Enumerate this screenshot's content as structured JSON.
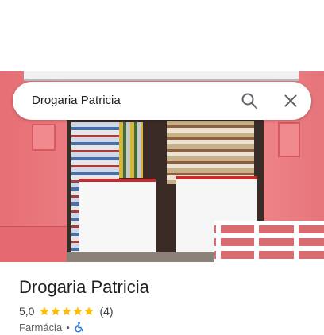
{
  "search": {
    "query": "Drogaria Patricia",
    "search_icon": "search-icon",
    "close_icon": "close-icon"
  },
  "place": {
    "title": "Drogaria Patricia",
    "rating": "5,0",
    "stars_filled": 5,
    "stars_total": 5,
    "review_count": "(4)",
    "category": "Farmácia",
    "separator": "•",
    "accessibility_icon": "wheelchair-icon"
  },
  "colors": {
    "star": "#fbbc04",
    "accessibility": "#1a73e8",
    "title": "#202124"
  }
}
